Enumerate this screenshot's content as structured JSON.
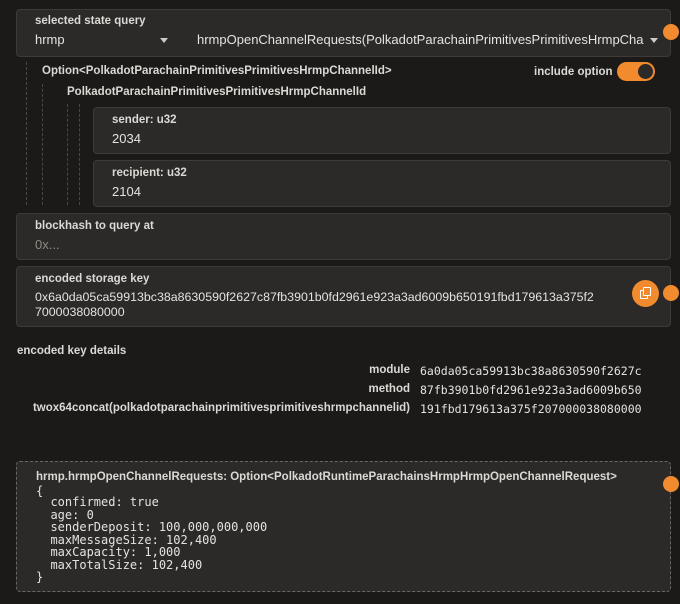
{
  "query": {
    "label": "selected state query",
    "module": "hrmp",
    "method": "hrmpOpenChannelRequests(PolkadotParachainPrimitivesPrimitivesHrmpChan"
  },
  "param": {
    "option_label": "Option<PolkadotParachainPrimitivesPrimitivesHrmpChannelId>",
    "include_option_label": "include option",
    "include_option": true,
    "struct_label": "PolkadotParachainPrimitivesPrimitivesHrmpChannelId",
    "sender_label": "sender: u32",
    "sender_value": "2034",
    "recipient_label": "recipient: u32",
    "recipient_value": "2104"
  },
  "blockhash": {
    "label": "blockhash to query at",
    "placeholder": "0x..."
  },
  "storage_key": {
    "label": "encoded storage key",
    "line1": "0x6a0da05ca59913bc38a8630590f2627c87fb3901b0fd2961e923a3ad6009b650191fbd179613a375f2",
    "line2": "7000038080000"
  },
  "key_details": {
    "title": "encoded key details",
    "rows": [
      {
        "key": "module",
        "value": "6a0da05ca59913bc38a8630590f2627c"
      },
      {
        "key": "method",
        "value": "87fb3901b0fd2961e923a3ad6009b650"
      },
      {
        "key": "twox64concat(polkadotparachainprimitivesprimitiveshrmpchannelid)",
        "value": "191fbd179613a375f207000038080000"
      }
    ]
  },
  "result": {
    "header": "hrmp.hrmpOpenChannelRequests: Option<PolkadotRuntimeParachainsHrmpHrmpOpenChannelRequest>",
    "lines": [
      "{",
      "  confirmed: true",
      "  age: 0",
      "  senderDeposit: 100,000,000,000",
      "  maxMessageSize: 102,400",
      "  maxCapacity: 1,000",
      "  maxTotalSize: 102,400",
      "}"
    ]
  },
  "colors": {
    "accent": "#f28a2e",
    "background": "#1b1a19",
    "panel": "#2b2a29"
  }
}
